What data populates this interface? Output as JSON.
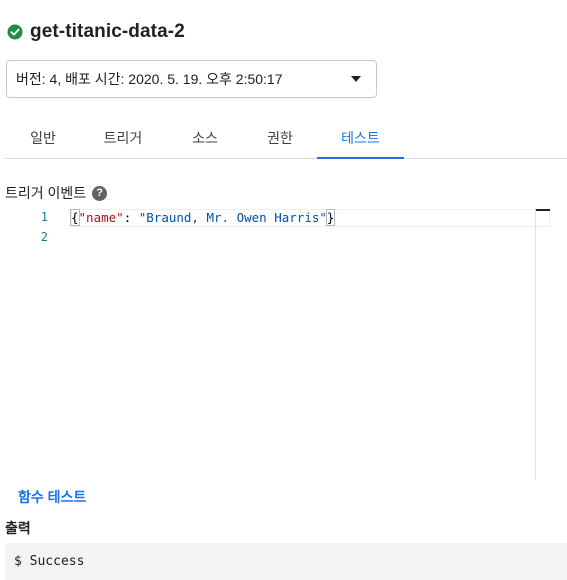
{
  "function": {
    "name": "get-titanic-data-2",
    "status": "active",
    "status_color": "#1e8e3e"
  },
  "version_select": {
    "value": "버전: 4, 배포 시간: 2020. 5. 19. 오후 2:50:17"
  },
  "tabs": [
    {
      "label": "일반",
      "active": false
    },
    {
      "label": "트리거",
      "active": false
    },
    {
      "label": "소스",
      "active": false
    },
    {
      "label": "권한",
      "active": false
    },
    {
      "label": "테스트",
      "active": true
    }
  ],
  "trigger_event": {
    "label": "트리거 이벤트",
    "help_icon": "help-circle-icon",
    "help_glyph": "?",
    "lines": [
      {
        "number": "1",
        "tokens": [
          {
            "text": "{",
            "kind": "punct"
          },
          {
            "text": "\"name\"",
            "kind": "key"
          },
          {
            "text": ": ",
            "kind": "punct"
          },
          {
            "text": "\"Braund, Mr. Owen Harris\"",
            "kind": "string"
          },
          {
            "text": "}",
            "kind": "punct"
          }
        ]
      },
      {
        "number": "2",
        "tokens": []
      }
    ]
  },
  "test_button": {
    "label": "함수 테스트"
  },
  "output": {
    "label": "출력",
    "text": "$ Success"
  },
  "colors": {
    "accent": "#1a73e8",
    "text": "#202124",
    "success": "#1e8e3e"
  }
}
